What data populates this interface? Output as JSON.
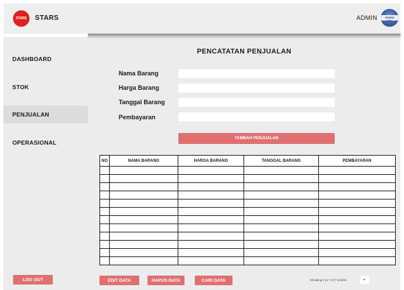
{
  "header": {
    "logo_text": "STARS",
    "brand": "STARS",
    "user_label": "ADMIN",
    "avatar_text": "STARS PRO"
  },
  "sidebar": {
    "items": [
      {
        "label": "DASHBOARD",
        "active": false
      },
      {
        "label": "STOK",
        "active": false
      },
      {
        "label": "PENJUALAN",
        "active": true
      },
      {
        "label": "OPERASIONAL",
        "active": false
      }
    ],
    "logout_label": "LOG OUT"
  },
  "page": {
    "title": "PENCATATAN PENJUALAN",
    "form": {
      "nama_label": "Nama Barang",
      "harga_label": "Harga Barang",
      "tanggal_label": "Tanggal Barang",
      "pembayaran_label": "Pembayaran",
      "nama_value": "",
      "harga_value": "",
      "tanggal_value": "",
      "pembayaran_value": "",
      "submit_label": "TAMBAH PENJUALAN"
    },
    "table": {
      "columns": [
        "NO",
        "NAMA BARANG",
        "HARGA BARANG",
        "TANGGAL BARANG",
        "PEMBAYARAN"
      ],
      "row_count": 12
    },
    "actions": {
      "edit_label": "EDIT DATA",
      "delete_label": "HAPUS DATA",
      "search_label": "CARI DATA",
      "entries_text": "Showing 1 to 7 of 7 entries",
      "next_glyph": "▸"
    }
  },
  "colors": {
    "accent": "#e07070",
    "logo_red": "#e02020",
    "panel": "#ececec"
  }
}
